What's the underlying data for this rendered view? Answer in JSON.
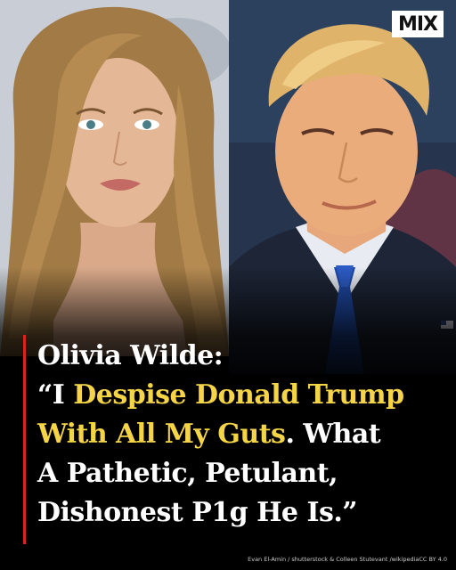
{
  "brand": {
    "logo_text": "MIX"
  },
  "headline": {
    "line1": "Olivia Wilde:",
    "line2_quote": "“I ",
    "line2_highlight": "Despise Donald Trump",
    "line3_highlight": "With All My Guts",
    "line3_rest": ". What",
    "line4": "A Pathetic, Petulant,",
    "line5": "Dishonest P1g He Is.”"
  },
  "credit": "Evan El-Amin / shutterstock & Colleen Stutevant /wikipediaCC BY 4.0",
  "colors": {
    "highlight": "#f5d547",
    "accent_bar": "#d7261e",
    "text": "#ffffff",
    "background": "#000000"
  }
}
